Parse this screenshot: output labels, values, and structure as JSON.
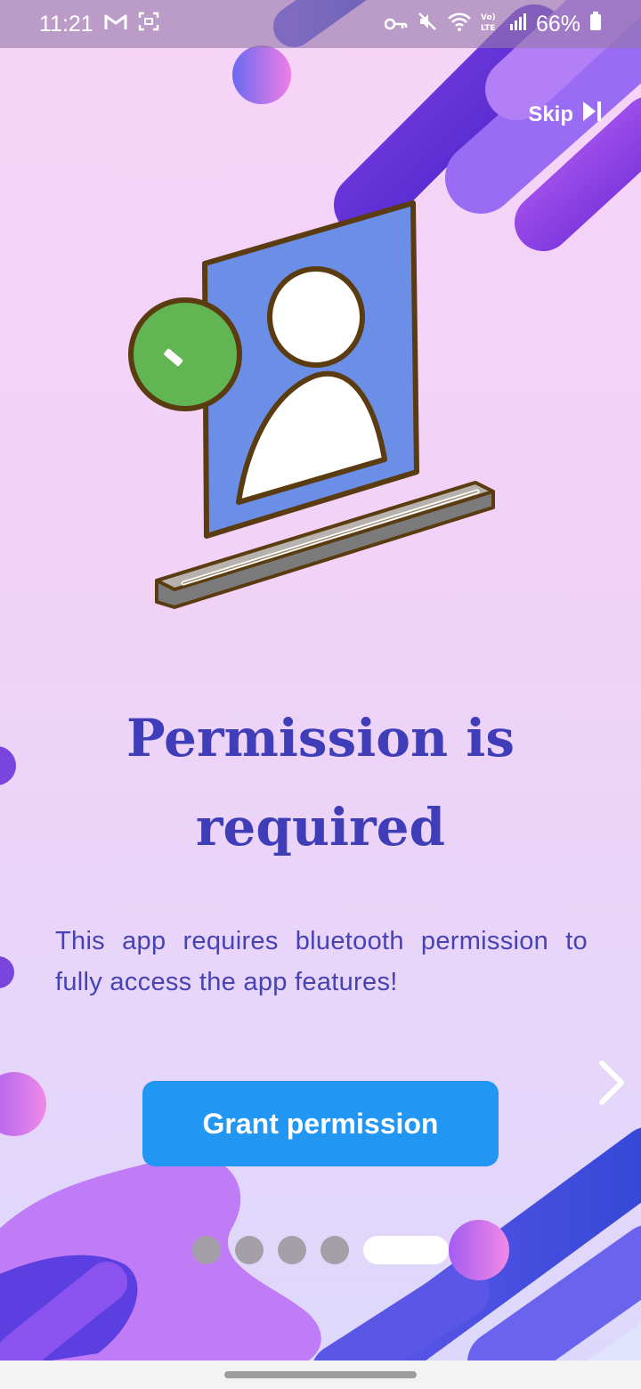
{
  "status_bar": {
    "time": "11:21",
    "battery": "66%",
    "icons": [
      "gmail-icon",
      "screenshot-icon",
      "vpn-key-icon",
      "mute-icon",
      "wifi-icon",
      "volte-icon",
      "signal-icon",
      "battery-icon"
    ]
  },
  "header": {
    "skip_label": "Skip",
    "skip_icon": "skip-next-icon"
  },
  "illustration": {
    "icon": "user-profile-permission-illustration",
    "colors": {
      "card": "#6b8ee6",
      "badge": "#61b552",
      "outline": "#5b3b10"
    }
  },
  "content": {
    "title": "Permission is required",
    "description": "This app requires bluetooth permission to fully access the app features!",
    "button_label": "Grant permission",
    "next_icon": "chevron-right-icon"
  },
  "pagination": {
    "total": 5,
    "current": 5
  },
  "colors": {
    "title": "#3f3db8",
    "description": "#4743b4",
    "button": "#2196f3",
    "dot_inactive": "#a3a1a7",
    "dot_active": "#ffffff"
  }
}
